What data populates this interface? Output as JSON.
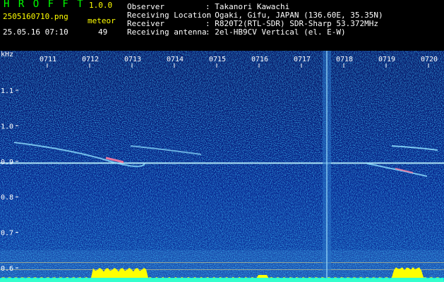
{
  "header": {
    "app_title": "H R O F F T",
    "app_version": "1.0.0",
    "file_name": "2505160710.png",
    "meteor_label": "meteor",
    "date_time": "25.05.16 07:10",
    "meteor_count": "49",
    "fields": [
      {
        "label": "Observer",
        "value": ": Takanori Kawachi"
      },
      {
        "label": "Receiving Location",
        "value": ": Ogaki, Gifu, JAPAN (136.60E, 35.35N)"
      },
      {
        "label": "Receiver",
        "value": ": R820T2(RTL-SDR) SDR-Sharp 53.372MHz"
      },
      {
        "label": "Receiving antenna",
        "value": ": 2el-HB9CV Vertical (el. E-W)"
      }
    ]
  },
  "colors": {
    "background": "#000000",
    "spectrogram_base": "#000a6e",
    "text_yellow": "#ffff00",
    "text_white": "#ffffff",
    "title_green": "#00ff00",
    "signal_band": "#9ff0ff",
    "meteor_trace": "#ffff00"
  },
  "chart_data": {
    "type": "heatmap",
    "ylabel": "kHz",
    "ylim": [
      0.58,
      1.2
    ],
    "y_ticks": [
      "1.1",
      "1.0",
      "0.9",
      "0.8",
      "0.7",
      "0.6"
    ],
    "y_tick_values": [
      1.1,
      1.0,
      0.9,
      0.8,
      0.7,
      0.6
    ],
    "x_ticks": [
      "0711",
      "0712",
      "0713",
      "0714",
      "0715",
      "0716",
      "0717",
      "0718",
      "0719",
      "0720"
    ],
    "x_tick_values": [
      11,
      12,
      13,
      14,
      15,
      16,
      17,
      18,
      19,
      20
    ],
    "xlim": [
      10.05,
      20.35
    ],
    "carrier_khz": 0.895,
    "vertical_burst_minute": 17.6
  }
}
